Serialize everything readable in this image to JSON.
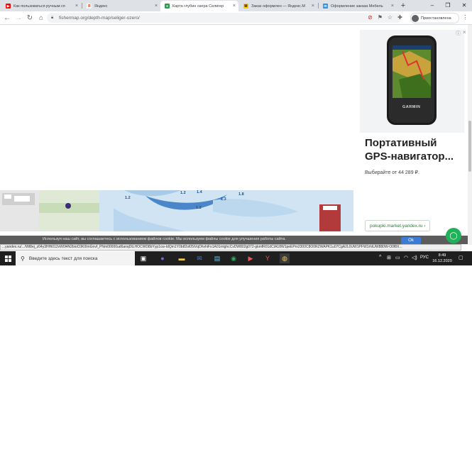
{
  "browser": {
    "tabs": [
      {
        "title": "Как пользоваться ручным сп",
        "favicon": "youtube-icon",
        "color": "#ff0000",
        "active": false
      },
      {
        "title": "Яндекс",
        "favicon": "yandex-icon",
        "color": "#fc3f1d",
        "active": false
      },
      {
        "title": "Карта глубин озера Селигер",
        "favicon": "fishermap-icon",
        "color": "#2e9d4f",
        "active": true
      },
      {
        "title": "Заказ оформлен — Яндекс.М",
        "favicon": "yandex-market-icon",
        "color": "#ffcc00",
        "active": false
      },
      {
        "title": "Оформление заказа Мебель",
        "favicon": "mebel-icon",
        "color": "#2196f3",
        "active": false
      }
    ],
    "url": "fishermap.org/depth-map/seliger-ozero/",
    "profile_label": "Приостановлена"
  },
  "ad": {
    "title": "Портативный GPS-навигатор...",
    "price_text": "Выбирайте от 44 289 ₽.",
    "link_text": "pokupki.market.yandex.ru ›",
    "device_brand": "GARMIN"
  },
  "map": {
    "depth_labels": [
      "1.2",
      "1.4",
      "1.2",
      "1.8",
      "1.3",
      "1.2"
    ]
  },
  "cookie_banner": {
    "text": "Используя наш сайт, вы соглашаетесь с использованием файлов cookie. Мы используем файлы cookie для улучшения работы сайта.",
    "ok_label": "Ok"
  },
  "status_bar": {
    "text": "...yandex.ru/.../Wt8ej_z04y3HHi012vW0l4N2bioC0K0ImGnvf_PNm00000ud6anqDtLHOCWD8bYyp1cw-IdQm1Y0btf2oI05iVqDhvhiFo1A01mlghcCvDW802g072-gkmfR01dCIA18W1peEPm2300C8O0RZWAPK1u07CgA2L0UW1PFW1rhtUW880W-O0f8X..."
  },
  "taskbar": {
    "search_placeholder": "Введите здесь текст для поиска",
    "language": "РУС",
    "time": "8:49",
    "date": "16.12.2020"
  }
}
